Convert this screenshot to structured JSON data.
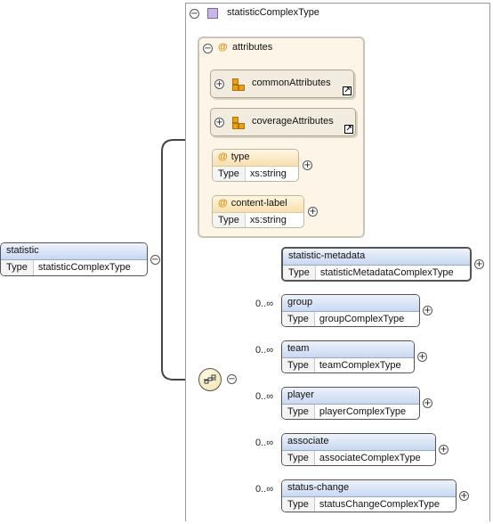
{
  "root": {
    "name": "statistic",
    "type_key": "Type",
    "type_value": "statisticComplexType"
  },
  "complex_type": {
    "name": "statisticComplexType"
  },
  "attributes_group": {
    "label": "attributes",
    "groups": [
      {
        "name": "commonAttributes"
      },
      {
        "name": "coverageAttributes"
      }
    ],
    "items": [
      {
        "name": "type",
        "type_key": "Type",
        "type_value": "xs:string"
      },
      {
        "name": "content-label",
        "type_key": "Type",
        "type_value": "xs:string"
      }
    ]
  },
  "sequence": {
    "children": [
      {
        "name": "statistic-metadata",
        "type_key": "Type",
        "type_value": "statisticMetadataComplexType",
        "cardinality": ""
      },
      {
        "name": "group",
        "type_key": "Type",
        "type_value": "groupComplexType",
        "cardinality": "0..∞"
      },
      {
        "name": "team",
        "type_key": "Type",
        "type_value": "teamComplexType",
        "cardinality": "0..∞"
      },
      {
        "name": "player",
        "type_key": "Type",
        "type_value": "playerComplexType",
        "cardinality": "0..∞"
      },
      {
        "name": "associate",
        "type_key": "Type",
        "type_value": "associateComplexType",
        "cardinality": "0..∞"
      },
      {
        "name": "status-change",
        "type_key": "Type",
        "type_value": "statusChangeComplexType",
        "cardinality": "0..∞"
      }
    ]
  },
  "symbols": {
    "expand": "+",
    "collapse": "−",
    "at": "@",
    "ref": "↗"
  },
  "colors": {
    "element_header": "#c8d8f2",
    "attribute_header": "#f8dfae",
    "attribute_panel": "#fdf6e8",
    "group_icon": "#e7a21a"
  }
}
